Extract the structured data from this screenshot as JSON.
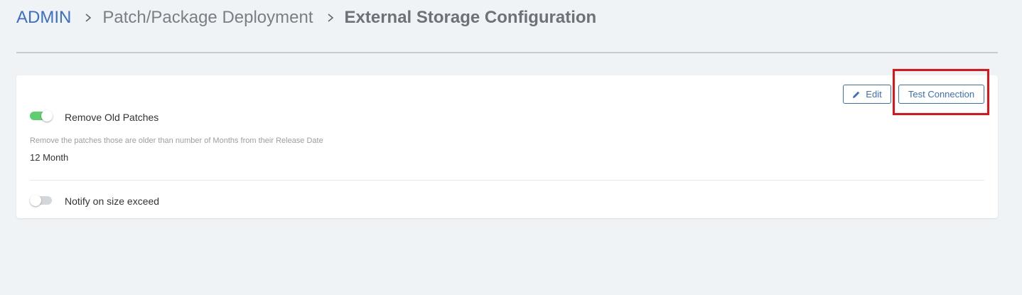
{
  "breadcrumb": {
    "items": [
      "ADMIN",
      "Patch/Package Deployment",
      "External Storage Configuration"
    ]
  },
  "toolbar": {
    "edit_label": "Edit",
    "test_connection_label": "Test Connection"
  },
  "settings": {
    "remove_old_patches": {
      "label": "Remove Old Patches",
      "enabled": true,
      "description": "Remove the patches those are older than number of Months from their Release Date",
      "value": "12 Month"
    },
    "notify_size_exceed": {
      "label": "Notify on size exceed",
      "enabled": false
    }
  },
  "colors": {
    "accent": "#3b6ec4",
    "toggle_on": "#5ecf6e",
    "highlight": "#e0121a"
  },
  "icons": [
    "chevron-right-icon",
    "pencil-icon"
  ]
}
